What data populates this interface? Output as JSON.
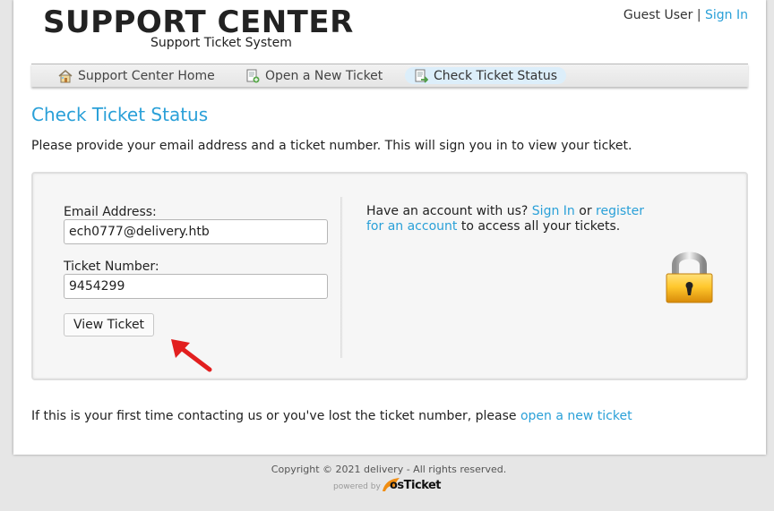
{
  "header": {
    "title": "SUPPORT CENTER",
    "subtitle": "Support Ticket System",
    "user_label": "Guest User |",
    "sign_in_label": "Sign In"
  },
  "nav": {
    "items": [
      {
        "label": "Support Center Home",
        "icon": "home-icon",
        "active": false
      },
      {
        "label": "Open a New Ticket",
        "icon": "new-ticket-icon",
        "active": false
      },
      {
        "label": "Check Ticket Status",
        "icon": "ticket-status-icon",
        "active": true
      }
    ]
  },
  "page": {
    "title": "Check Ticket Status",
    "intro": "Please provide your email address and a ticket number. This will sign you in to view your ticket."
  },
  "form": {
    "email": {
      "label": "Email Address:",
      "value": "ech0777@delivery.htb",
      "placeholder": ""
    },
    "ticket": {
      "label": "Ticket Number:",
      "value": "9454299",
      "placeholder": ""
    },
    "submit_label": "View Ticket"
  },
  "account_prompt": {
    "before_sign_in": "Have an account with us?",
    "sign_in_link": "Sign In",
    "connector": "or",
    "register_link": "register for an account",
    "after_register": "to access all your tickets."
  },
  "help": {
    "text": "If this is your first time contacting us or you've lost the ticket number, please",
    "link": "open a new ticket"
  },
  "footer": {
    "copyright": "Copyright © 2021 delivery - All rights reserved.",
    "powered_by": "powered by",
    "brand": "osTicket"
  },
  "colors": {
    "accent": "#2aa0d8",
    "background": "#e6e6e6",
    "panel": "#f6f6f6"
  }
}
